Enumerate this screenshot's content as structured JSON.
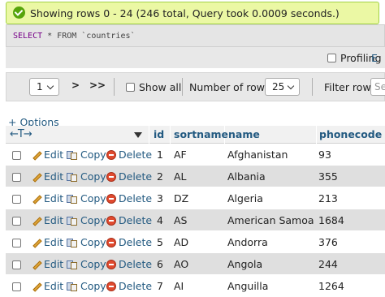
{
  "success": {
    "message": "Showing rows 0 - 24 (246 total, Query took 0.0009 seconds.)"
  },
  "sql": {
    "keyword": "SELECT",
    "rest": " * FROM `countries`"
  },
  "profiling": {
    "label": "Profiling [",
    "link": "E"
  },
  "nav": {
    "page_value": "1",
    "next_label": ">",
    "last_label": ">>",
    "show_all_label": "Show all",
    "number_of_rows_label": "Number of rows:",
    "rows_value": "25",
    "filter_label": "Filter rows:",
    "filter_placeholder": "Se"
  },
  "options_label": "+ Options",
  "table": {
    "arrows": "←T→",
    "columns": [
      "id",
      "sortname",
      "name",
      "phonecode"
    ],
    "actions": {
      "edit": "Edit",
      "copy": "Copy",
      "delete": "Delete"
    },
    "rows": [
      {
        "id": "1",
        "sortname": "AF",
        "name": "Afghanistan",
        "phonecode": "93"
      },
      {
        "id": "2",
        "sortname": "AL",
        "name": "Albania",
        "phonecode": "355"
      },
      {
        "id": "3",
        "sortname": "DZ",
        "name": "Algeria",
        "phonecode": "213"
      },
      {
        "id": "4",
        "sortname": "AS",
        "name": "American Samoa",
        "phonecode": "1684"
      },
      {
        "id": "5",
        "sortname": "AD",
        "name": "Andorra",
        "phonecode": "376"
      },
      {
        "id": "6",
        "sortname": "AO",
        "name": "Angola",
        "phonecode": "244"
      },
      {
        "id": "7",
        "sortname": "AI",
        "name": "Anguilla",
        "phonecode": "1264"
      }
    ]
  },
  "colors": {
    "link": "#235a81",
    "success_bg": "#ebf8a4",
    "row_alt": "#dfdfdf"
  }
}
